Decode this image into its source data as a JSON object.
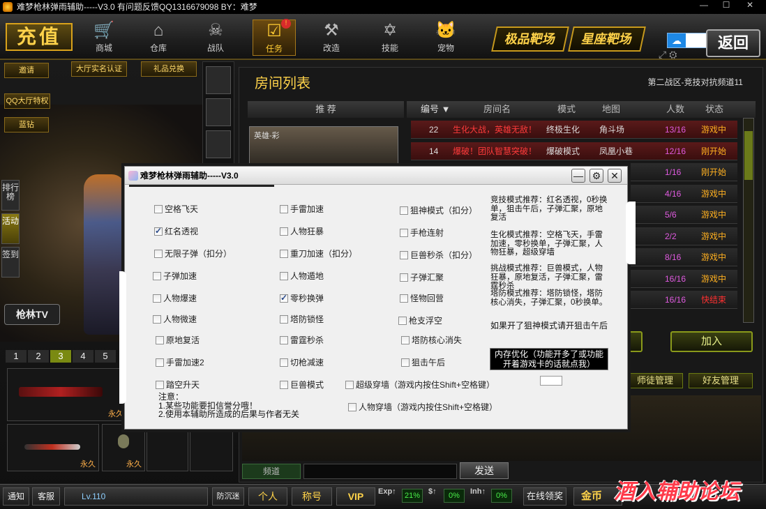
{
  "titlebar": {
    "text": "难梦枪林弹雨辅助-----V3.0    有问题反馈QQ1316679098      BY：难梦",
    "min": "—",
    "max": "☐",
    "close": "✕"
  },
  "topnav": {
    "recharge": "充值",
    "items": [
      {
        "label": "商城",
        "icon": "cart-icon"
      },
      {
        "label": "仓库",
        "icon": "warehouse-icon"
      },
      {
        "label": "战队",
        "icon": "skull-icon"
      },
      {
        "label": "任务",
        "icon": "clipboard-icon",
        "badge": "!"
      },
      {
        "label": "改造",
        "icon": "tools-icon"
      },
      {
        "label": "技能",
        "icon": "star-icon"
      },
      {
        "label": "宠物",
        "icon": "cat-icon"
      }
    ],
    "range1": "极品靶场",
    "range2": "星座靶场",
    "return": "返回"
  },
  "left": {
    "invite": "邀请",
    "realname": "大厅实名认证",
    "gift": "礼品兑换",
    "qqvip": "QQ大厅特权",
    "bluediamond": "蓝钻",
    "sidetabs": [
      "排行榜",
      "活动",
      "签到"
    ],
    "tv": "枪林TV",
    "numtabs": [
      "1",
      "2",
      "3",
      "4",
      "5"
    ],
    "perm": "永久"
  },
  "room": {
    "title": "房间列表",
    "subtitle": "第二战区-竞技对抗频道11",
    "recommend": "推 荐",
    "hero_label": "英雄-彩",
    "columns": {
      "num": "编号 ▼",
      "name": "房间名",
      "mode": "模式",
      "map": "地图",
      "players": "人数",
      "status": "状态"
    },
    "rows": [
      {
        "num": "22",
        "name": "生化大战，英雄无敌！",
        "mode": "终极生化",
        "map": "角斗场",
        "players": "13/16",
        "status": "游戏中"
      },
      {
        "num": "14",
        "name": "爆破！团队智慧突破！",
        "mode": "爆破模式",
        "map": "凤凰小巷",
        "players": "12/16",
        "status": "刚开始"
      },
      {
        "num": "",
        "name": "",
        "mode": "",
        "map": "地",
        "players": "1/16",
        "status": "刚开始"
      },
      {
        "num": "",
        "name": "",
        "mode": "",
        "map": "",
        "players": "4/16",
        "status": "游戏中"
      },
      {
        "num": "",
        "name": "",
        "mode": "",
        "map": "威",
        "players": "5/6",
        "status": "游戏中"
      },
      {
        "num": "",
        "name": "",
        "mode": "",
        "map": "延节",
        "players": "2/2",
        "status": "游戏中"
      },
      {
        "num": "",
        "name": "",
        "mode": "",
        "map": "争",
        "players": "8/16",
        "status": "游戏中"
      },
      {
        "num": "",
        "name": "",
        "mode": "",
        "map": "镇",
        "players": "16/16",
        "status": "游戏中"
      },
      {
        "num": "",
        "name": "",
        "mode": "",
        "map": "威",
        "players": "16/16",
        "status": "快结束"
      }
    ],
    "join": "加入",
    "create": "建",
    "mentor": "师徒管理",
    "friends": "好友管理",
    "channel": "频道",
    "send": "发送"
  },
  "bottom": {
    "notify": "通知",
    "service": "客服",
    "level": "Lv.110",
    "defense": "防沉迷",
    "personal": "个人",
    "title": "称号",
    "vip": "VIP",
    "exp_label": "Exp↑",
    "exp": "21%",
    "gold_label": "$↑",
    "gold_pct": "0%",
    "inh_label": "Inh↑",
    "inh": "0%",
    "online": "在线领奖",
    "coins": "金币"
  },
  "watermark": "酒入辅助论坛",
  "dialog": {
    "title": "难梦枪林弹雨辅助-----V3.0",
    "checks": [
      {
        "label": "空格飞天",
        "checked": false
      },
      {
        "label": "手雷加速",
        "checked": false
      },
      {
        "label": "狙神模式（扣分）",
        "checked": false
      },
      {
        "label": "红名透视",
        "checked": true
      },
      {
        "label": "人物狂暴",
        "checked": false
      },
      {
        "label": "手枪连射",
        "checked": false
      },
      {
        "label": "无限子弹（扣分）",
        "checked": false
      },
      {
        "label": "重刀加速（扣分）",
        "checked": false
      },
      {
        "label": "巨兽秒杀（扣分）",
        "checked": false
      },
      {
        "label": "子弹加速",
        "checked": false
      },
      {
        "label": "人物遁地",
        "checked": false
      },
      {
        "label": "子弹汇聚",
        "checked": false
      },
      {
        "label": "人物爆速",
        "checked": false
      },
      {
        "label": "零秒换弹",
        "checked": true
      },
      {
        "label": "怪物回营",
        "checked": false
      },
      {
        "label": "人物微速",
        "checked": false
      },
      {
        "label": "塔防锁怪",
        "checked": false
      },
      {
        "label": "枪支浮空",
        "checked": false
      },
      {
        "label": "原地复活",
        "checked": false
      },
      {
        "label": "雷霆秒杀",
        "checked": false
      },
      {
        "label": "塔防核心消失",
        "checked": false
      },
      {
        "label": "手雷加速2",
        "checked": false
      },
      {
        "label": "切枪减速",
        "checked": false
      },
      {
        "label": "狙击午后",
        "checked": false
      },
      {
        "label": "踏空升天",
        "checked": false
      },
      {
        "label": "巨兽模式",
        "checked": false
      },
      {
        "label": "超级穿墙（游戏内按住Shift+空格键）",
        "checked": false
      },
      {
        "label": "人物穿墙（游戏内按住Shift+空格键）",
        "checked": false
      }
    ],
    "rec1": "竞技模式推荐：红名透视，0秒换单，狙击午后，子弹汇聚，原地复活",
    "rec2": "生化模式推荐：空格飞天，手雷加速，零秒换单，子弹汇聚，人物狂暴，超级穿墙",
    "rec3": "挑战模式推荐：巨兽模式，人物狂暴，原地复活，子弹汇聚，雷霆秒杀",
    "rec4": "塔防模式推荐：塔防锁怪，塔防核心消失，子弹汇聚，0秒换单。",
    "rec5": "如果开了狙神模式请开狙击午后",
    "memopt": "内存优化（功能开多了或功能开着游戏卡的话就点我）",
    "note_title": "注意：",
    "note1": "1.某些功能要扣信誉分哦！",
    "note2": "2.使用本辅助所造成的后果与作者无关"
  }
}
